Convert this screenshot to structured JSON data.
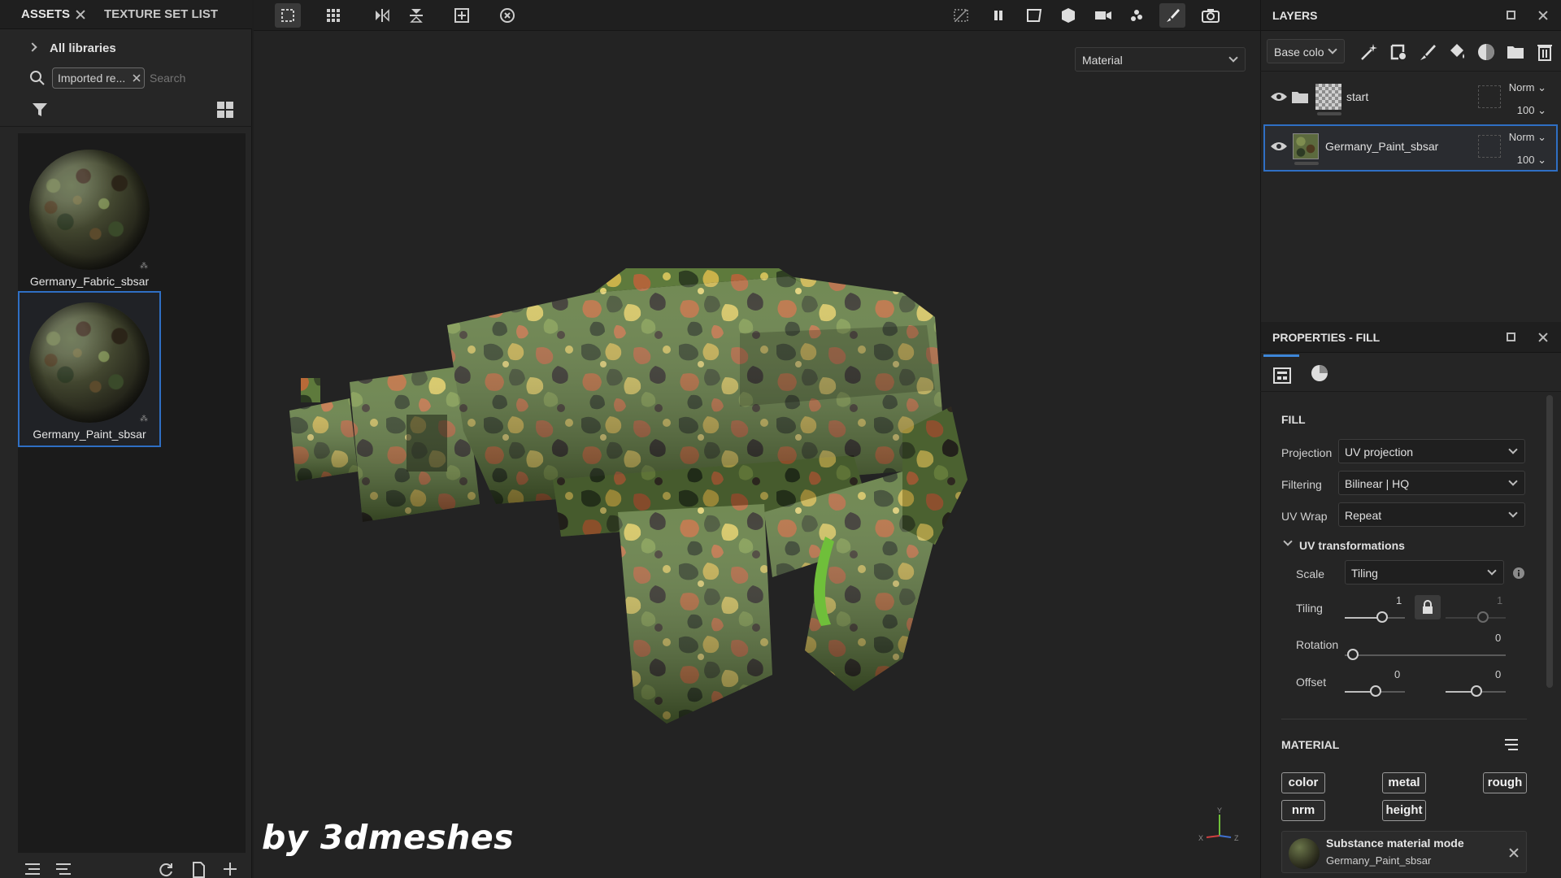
{
  "assets_panel": {
    "tabs": [
      {
        "label": "ASSETS"
      },
      {
        "label": "TEXTURE SET LIST"
      }
    ],
    "library_label": "All libraries",
    "filter_chip": "Imported re...",
    "search_placeholder": "Search",
    "items": [
      {
        "name": "Germany_Fabric_sbsar",
        "selected": false
      },
      {
        "name": "Germany_Paint_sbsar",
        "selected": true
      }
    ]
  },
  "viewport": {
    "channel_select": "Material",
    "watermark": "by 3dmeshes",
    "axis_labels": {
      "x": "X",
      "y": "Y",
      "z": "Z"
    }
  },
  "layers_panel": {
    "title": "LAYERS",
    "channel_dropdown": "Base colo",
    "layers": [
      {
        "name": "start",
        "blend_mode": "Norm",
        "opacity": "100",
        "type": "folder",
        "selected": false
      },
      {
        "name": "Germany_Paint_sbsar",
        "blend_mode": "Norm",
        "opacity": "100",
        "type": "fill",
        "selected": true
      }
    ]
  },
  "properties_panel": {
    "title": "PROPERTIES - FILL",
    "fill_section": "FILL",
    "projection": {
      "label": "Projection",
      "value": "UV projection"
    },
    "filtering": {
      "label": "Filtering",
      "value": "Bilinear | HQ"
    },
    "uv_wrap": {
      "label": "UV Wrap",
      "value": "Repeat"
    },
    "uv_transformations": {
      "title": "UV transformations",
      "scale": {
        "label": "Scale",
        "value": "Tiling"
      },
      "tiling": {
        "label": "Tiling",
        "value_1": "1",
        "value_2": "1"
      },
      "rotation": {
        "label": "Rotation",
        "value": "0"
      },
      "offset": {
        "label": "Offset",
        "value_1": "0",
        "value_2": "0"
      }
    },
    "material_section": "MATERIAL",
    "channels": [
      "color",
      "metal",
      "rough",
      "nrm",
      "height"
    ],
    "substance_mode": {
      "title": "Substance material mode",
      "material": "Germany_Paint_sbsar"
    }
  },
  "colors": {
    "accent": "#2f6fc4",
    "background": "#1e1e1e",
    "uv_green": "#6fbf3a"
  }
}
